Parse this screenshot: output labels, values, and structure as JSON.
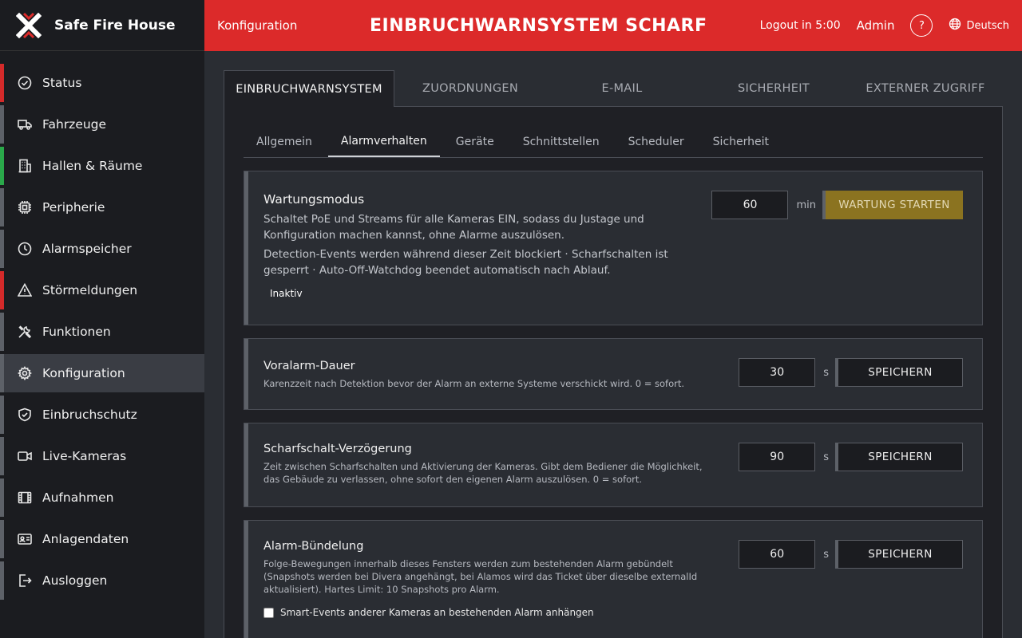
{
  "brand": {
    "name": "Safe Fire House",
    "logo_icon": "x-logo-icon"
  },
  "header": {
    "section": "Konfiguration",
    "status_title": "EINBRUCHWARNSYSTEM SCHARF",
    "logout_timer": "Logout in 5:00",
    "user": "Admin",
    "help_label": "?",
    "language": "Deutsch",
    "bar_color": "#dc2a2a"
  },
  "sidebar": {
    "items": [
      {
        "label": "Status",
        "icon": "check-circle-icon",
        "indicator": "#d42a2a"
      },
      {
        "label": "Fahrzeuge",
        "icon": "truck-icon",
        "indicator": "#5d6168"
      },
      {
        "label": "Hallen & Räume",
        "icon": "building-icon",
        "indicator": "#2aa84a"
      },
      {
        "label": "Peripherie",
        "icon": "chip-icon",
        "indicator": "#5d6168"
      },
      {
        "label": "Alarmspeicher",
        "icon": "clock-icon",
        "indicator": "#5d6168"
      },
      {
        "label": "Störmeldungen",
        "icon": "warning-icon",
        "indicator": "#d42a2a"
      },
      {
        "label": "Funktionen",
        "icon": "tools-icon",
        "indicator": "#5d6168"
      },
      {
        "label": "Konfiguration",
        "icon": "gear-icon",
        "indicator": "#5d6168",
        "active": true
      },
      {
        "label": "Einbruchschutz",
        "icon": "shield-icon",
        "indicator": "#5d6168"
      },
      {
        "label": "Live-Kameras",
        "icon": "video-camera-icon",
        "indicator": "#5d6168"
      },
      {
        "label": "Aufnahmen",
        "icon": "film-icon",
        "indicator": "#5d6168"
      },
      {
        "label": "Anlagendaten",
        "icon": "id-card-icon",
        "indicator": "#5d6168"
      },
      {
        "label": "Ausloggen",
        "icon": "logout-icon",
        "indicator": "#5d6168"
      }
    ]
  },
  "main": {
    "tabs": [
      {
        "label": "EINBRUCHWARNSYSTEM",
        "active": true
      },
      {
        "label": "ZUORDNUNGEN"
      },
      {
        "label": "E-MAIL"
      },
      {
        "label": "SICHERHEIT"
      },
      {
        "label": "EXTERNER ZUGRIFF"
      }
    ],
    "subtabs": [
      {
        "label": "Allgemein"
      },
      {
        "label": "Alarmverhalten",
        "active": true
      },
      {
        "label": "Geräte"
      },
      {
        "label": "Schnittstellen"
      },
      {
        "label": "Scheduler"
      },
      {
        "label": "Sicherheit"
      }
    ],
    "maintenance": {
      "title": "Wartungsmodus",
      "desc1": "Schaltet PoE und Streams für alle Kameras EIN, sodass du Justage und Konfiguration machen kannst, ohne Alarme auszulösen.",
      "desc2": "Detection-Events werden während dieser Zeit blockiert · Scharfschalten ist gesperrt · Auto-Off-Watchdog beendet automatisch nach Ablauf.",
      "status": "Inaktiv",
      "value": "60",
      "unit": "min",
      "button": "WARTUNG STARTEN"
    },
    "prealarm": {
      "title": "Voralarm-Dauer",
      "desc": "Karenzzeit nach Detektion bevor der Alarm an externe Systeme verschickt wird. 0 = sofort.",
      "value": "30",
      "unit": "s",
      "button": "SPEICHERN"
    },
    "arm_delay": {
      "title": "Scharfschalt-Verzögerung",
      "desc": "Zeit zwischen Scharfschalten und Aktivierung der Kameras. Gibt dem Bediener die Möglichkeit, das Gebäude zu verlassen, ohne sofort den eigenen Alarm auszulösen. 0 = sofort.",
      "value": "90",
      "unit": "s",
      "button": "SPEICHERN"
    },
    "bundling": {
      "title": "Alarm-Bündelung",
      "desc": "Folge-Bewegungen innerhalb dieses Fensters werden zum bestehenden Alarm gebündelt (Snapshots werden bei Divera angehängt, bei Alamos wird das Ticket über dieselbe externalId aktualisiert). Hartes Limit: 10 Snapshots pro Alarm.",
      "value": "60",
      "unit": "s",
      "button": "SPEICHERN",
      "checkbox_label": "Smart-Events anderer Kameras an bestehenden Alarm anhängen",
      "checkbox_checked": false
    }
  }
}
